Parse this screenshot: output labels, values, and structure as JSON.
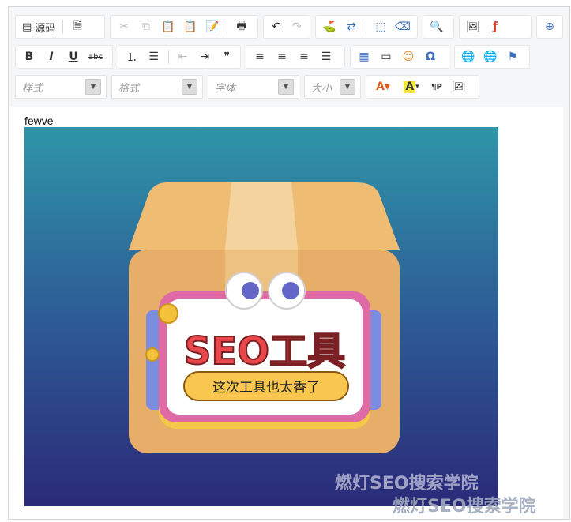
{
  "toolbar": {
    "source_label": "源码",
    "styles_placeholder": "样式",
    "format_placeholder": "格式",
    "font_placeholder": "字体",
    "size_placeholder": "大小",
    "bold": "B",
    "italic": "I",
    "underline": "U",
    "strike": "abc",
    "blockquote": "❞",
    "special_char": "Ω"
  },
  "content": {
    "paragraph": "fewve",
    "image": {
      "headline": "SEO工具",
      "subtitle": "这次工具也太香了",
      "watermark_primary": "燃灯SEO搜索学院",
      "watermark_secondary": "燃灯SEO搜索学院"
    }
  },
  "colors": {
    "bg_top": "#2f8fa8",
    "bg_bottom": "#2b2d7a",
    "box": "#e9b46c",
    "panel_border": "#e06aa6",
    "headline": "#e8484b",
    "pill": "#f9c74f"
  }
}
